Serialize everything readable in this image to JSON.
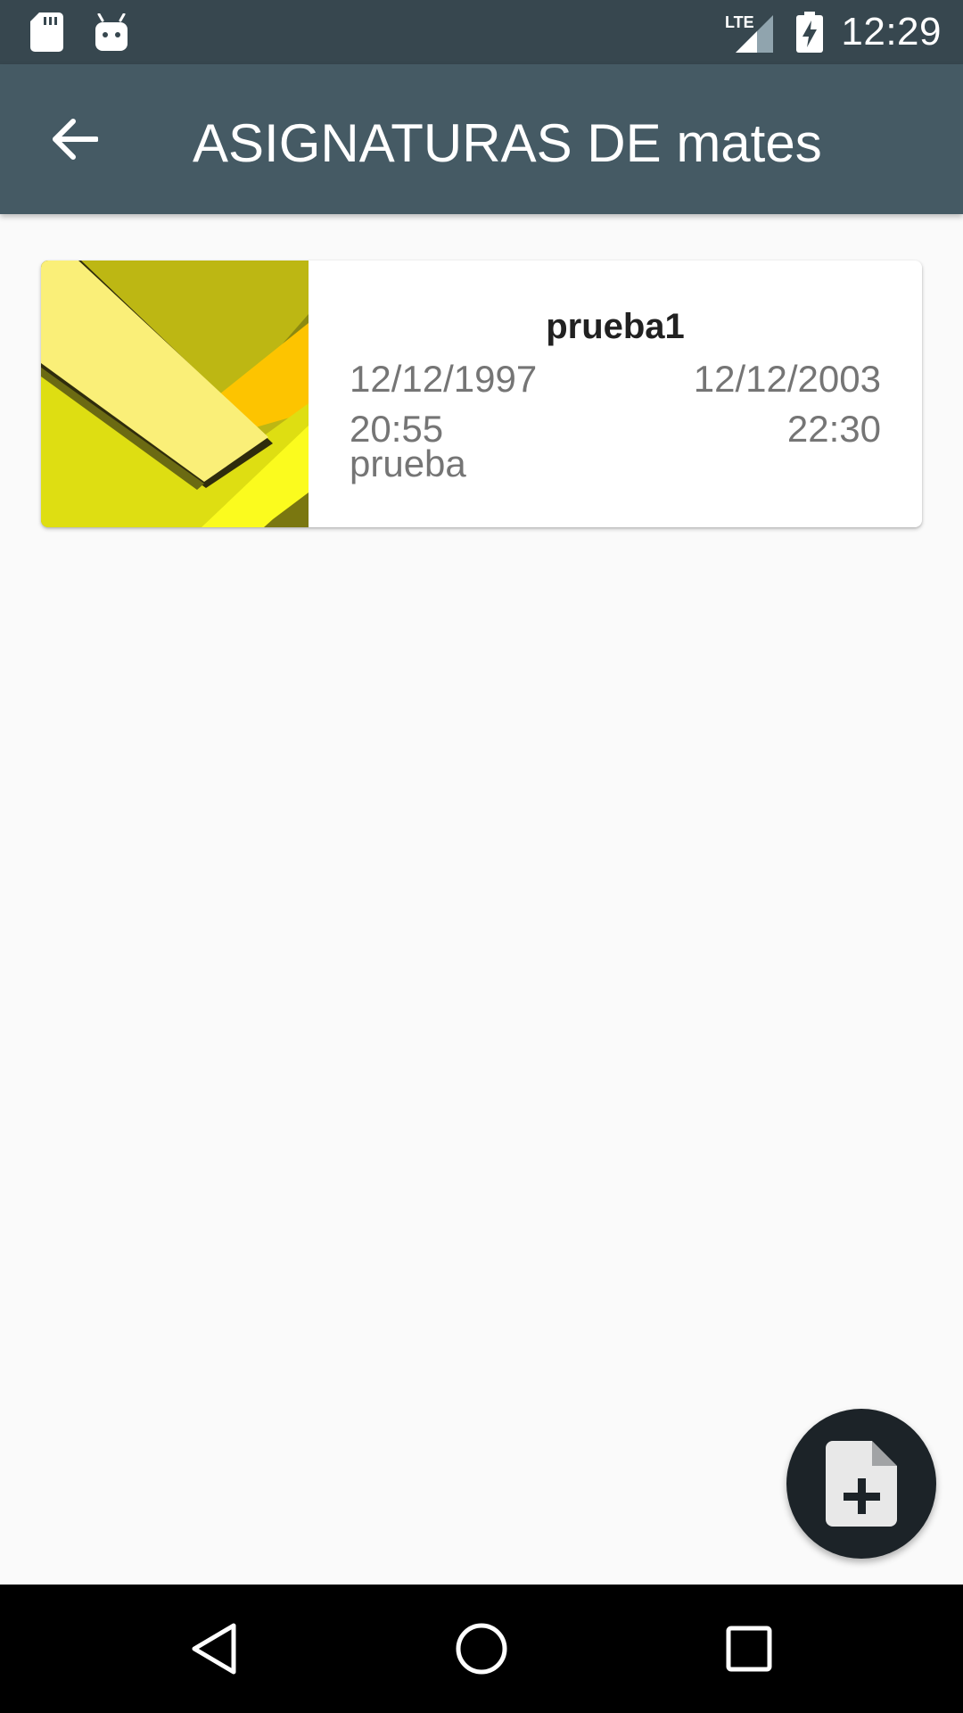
{
  "status_bar": {
    "time": "12:29",
    "network": "LTE",
    "icons": [
      "sd-card-icon",
      "android-debug-icon",
      "lte-signal-icon",
      "battery-charging-icon"
    ]
  },
  "app_bar": {
    "title": "ASIGNATURAS DE mates",
    "back_icon": "arrow-back-icon"
  },
  "items": [
    {
      "title": "prueba1",
      "start_date": "12/12/1997",
      "end_date": "12/12/2003",
      "start_time": "20:55",
      "end_time": "22:30",
      "description": "prueba"
    }
  ],
  "fab": {
    "icon": "note-add-icon"
  },
  "nav_bar": {
    "icons": [
      "nav-back-icon",
      "nav-home-icon",
      "nav-recents-icon"
    ]
  },
  "colors": {
    "status_bar": "#37474f",
    "app_bar": "#455a64",
    "background": "#fafafa",
    "fab": "#1c2328",
    "secondary_text": "#757575"
  }
}
